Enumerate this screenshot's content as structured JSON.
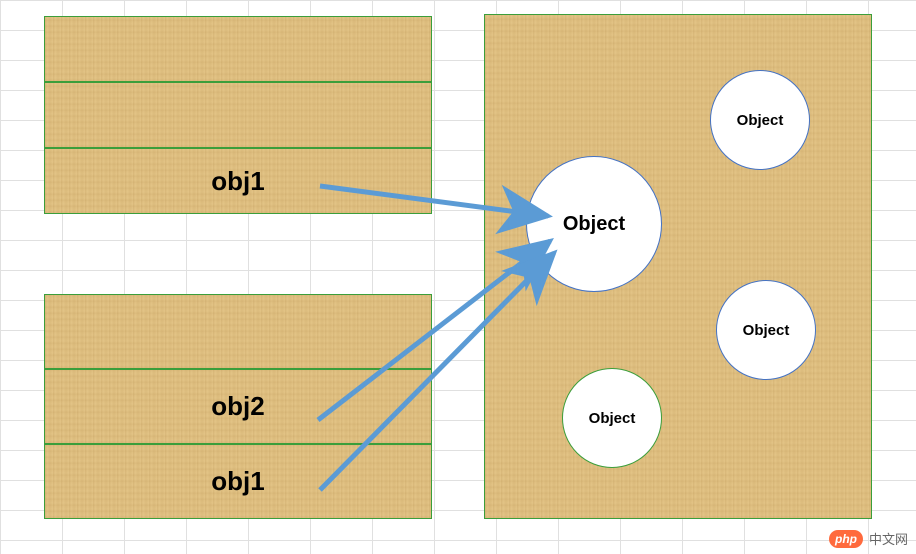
{
  "diagram": {
    "stacks": {
      "top": {
        "rows": [
          {
            "label": ""
          },
          {
            "label": ""
          },
          {
            "label": "obj1"
          }
        ]
      },
      "bottom": {
        "rows": [
          {
            "label": ""
          },
          {
            "label": "obj2"
          },
          {
            "label": "obj1"
          }
        ]
      }
    },
    "heap": {
      "objects": [
        {
          "label": "Object",
          "role": "target"
        },
        {
          "label": "Object"
        },
        {
          "label": "Object"
        },
        {
          "label": "Object"
        }
      ]
    },
    "arrows": {
      "count": 3,
      "stroke": "#5b9bd5",
      "from": [
        "top.obj1",
        "bottom.obj2",
        "bottom.obj1"
      ],
      "to": "heap.objects.0"
    },
    "colors": {
      "wood": "#e2c283",
      "border_green": "#3b9e3b",
      "border_blue": "#4472c4",
      "arrow": "#5b9bd5"
    }
  },
  "watermark": {
    "badge": "php",
    "text": "中文网"
  }
}
